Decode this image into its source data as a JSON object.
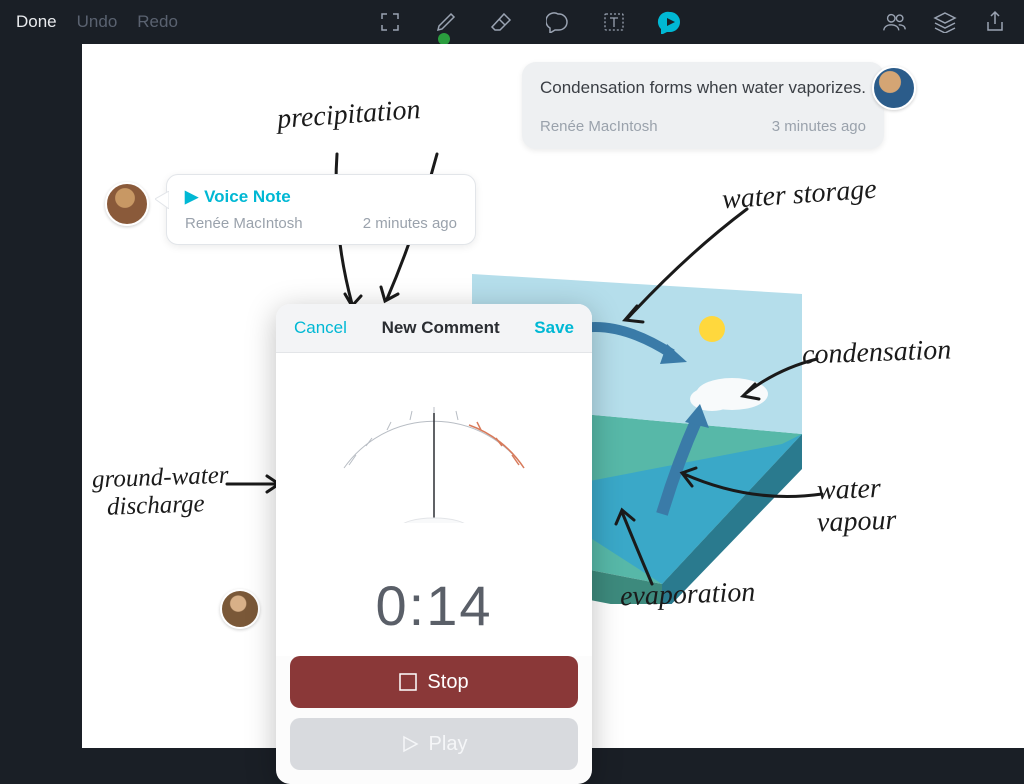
{
  "toolbar": {
    "done": "Done",
    "undo": "Undo",
    "redo": "Redo"
  },
  "comment1": {
    "text": "Condensation forms when water vaporizes.",
    "author": "Renée MacIntosh",
    "time": "3 minutes ago"
  },
  "voiceNote": {
    "label": "Voice Note",
    "author": "Renée MacIntosh",
    "time": "2 minutes ago"
  },
  "annotations": {
    "precipitation": "precipitation",
    "waterStorage": "water storage",
    "condensation": "condensation",
    "groundWater1": "ground-water",
    "groundWater2": "discharge",
    "evaporation": "evaporation",
    "waterVapour1": "water",
    "waterVapour2": "vapour"
  },
  "modal": {
    "cancel": "Cancel",
    "title": "New Comment",
    "save": "Save",
    "timer": "0:14",
    "stop": "Stop",
    "play": "Play"
  }
}
